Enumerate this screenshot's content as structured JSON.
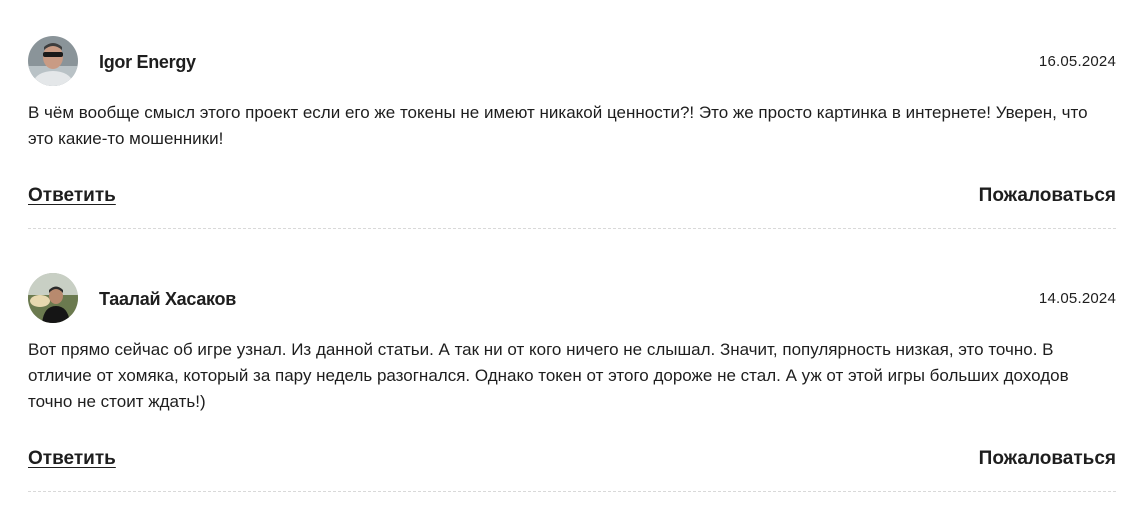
{
  "comments": [
    {
      "author": "Igor Energy",
      "date": "16.05.2024",
      "text": "В чём вообще смысл этого проект если его же токены не имеют никакой ценности?! Это же просто картинка в интернете! Уверен, что это какие-то мошенники!",
      "reply_label": "Ответить",
      "report_label": "Пожаловаться",
      "avatar_icon": "user-photo-avatar"
    },
    {
      "author": "Таалай Хасаков",
      "date": "14.05.2024",
      "text": "Вот прямо сейчас об игре узнал. Из данной статьи. А так ни от кого ничего не слышал. Значит, популярность низкая, это точно. В отличие от хомяка, который за пару недель разогнался. Однако токен от этого дороже не стал. А уж от этой игры больших доходов точно не стоит ждать!)",
      "reply_label": "Ответить",
      "report_label": "Пожаловаться",
      "avatar_icon": "user-photo-avatar"
    }
  ],
  "colors": {
    "text": "#1e1e1e",
    "divider": "#d9d9d9",
    "background": "#ffffff"
  }
}
